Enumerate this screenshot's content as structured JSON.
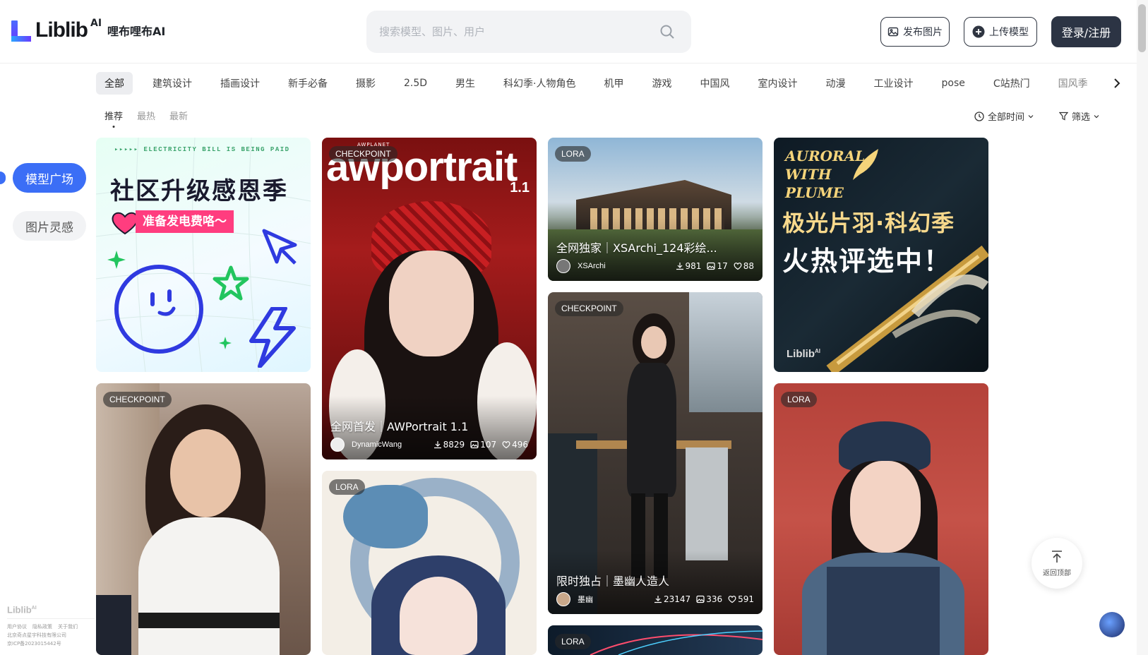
{
  "header": {
    "logo_text": "Liblib",
    "logo_ai": "AI",
    "logo_cn": "哩布哩布AI",
    "search_placeholder": "搜索模型、图片、用户",
    "publish_image_label": "发布图片",
    "upload_model_label": "上传模型",
    "login_label": "登录/注册"
  },
  "categories": [
    "全部",
    "建筑设计",
    "插画设计",
    "新手必备",
    "摄影",
    "2.5D",
    "男生",
    "科幻季·人物角色",
    "机甲",
    "游戏",
    "中国风",
    "室内设计",
    "动漫",
    "工业设计",
    "pose",
    "C站热门",
    "国风季"
  ],
  "subtabs": [
    "推荐",
    "最热",
    "最新"
  ],
  "filters": {
    "time_label": "全部时间",
    "filter_label": "筛选"
  },
  "sidebar": {
    "model_square": "模型广场",
    "image_inspiration": "图片灵感"
  },
  "footer": {
    "logo": "Liblib",
    "logo_ai": "AI",
    "links": [
      "用户协议",
      "隐私政策",
      "关于我们"
    ],
    "company": "北京奇点星宇科技有限公司",
    "icp": "京ICP备2023015442号"
  },
  "cards": {
    "promo1": {
      "banner": "▸▸▸▸▸ ELECTRICITY BILL IS BEING PAID",
      "headline": "社区升级感恩季",
      "sub": "准备发电费咯～"
    },
    "awportrait": {
      "badge": "CHECKPOINT",
      "brand": "AWPLANET",
      "art_title": "awportrait",
      "art_version": "1.1",
      "title": "全网首发｜AWPortrait 1.1",
      "author": "DynamicWang",
      "downloads": "8829",
      "images": "107",
      "likes": "496"
    },
    "xsarchi": {
      "badge": "LORA",
      "title": "全网独家｜XSArchi_124彩绘...",
      "author": "XSArchi",
      "downloads": "981",
      "images": "17",
      "likes": "88"
    },
    "promo2": {
      "en_line1": "AURORAL",
      "en_line2": "WITH",
      "en_line3": "PLUME",
      "headline1": "极光片羽·科幻季",
      "headline2": "火热评选中！",
      "logo": "Liblib",
      "logo_ai": "AI"
    },
    "portrait_left": {
      "badge": "CHECKPOINT"
    },
    "dragon": {
      "badge": "LORA"
    },
    "mechanic": {
      "badge": "CHECKPOINT",
      "title": "限时独占｜墨幽人造人",
      "author": "墨幽",
      "downloads": "23147",
      "images": "336",
      "likes": "591"
    },
    "neon": {
      "badge": "LORA"
    },
    "police": {
      "badge": "LORA"
    }
  },
  "to_top_label": "返回顶部"
}
